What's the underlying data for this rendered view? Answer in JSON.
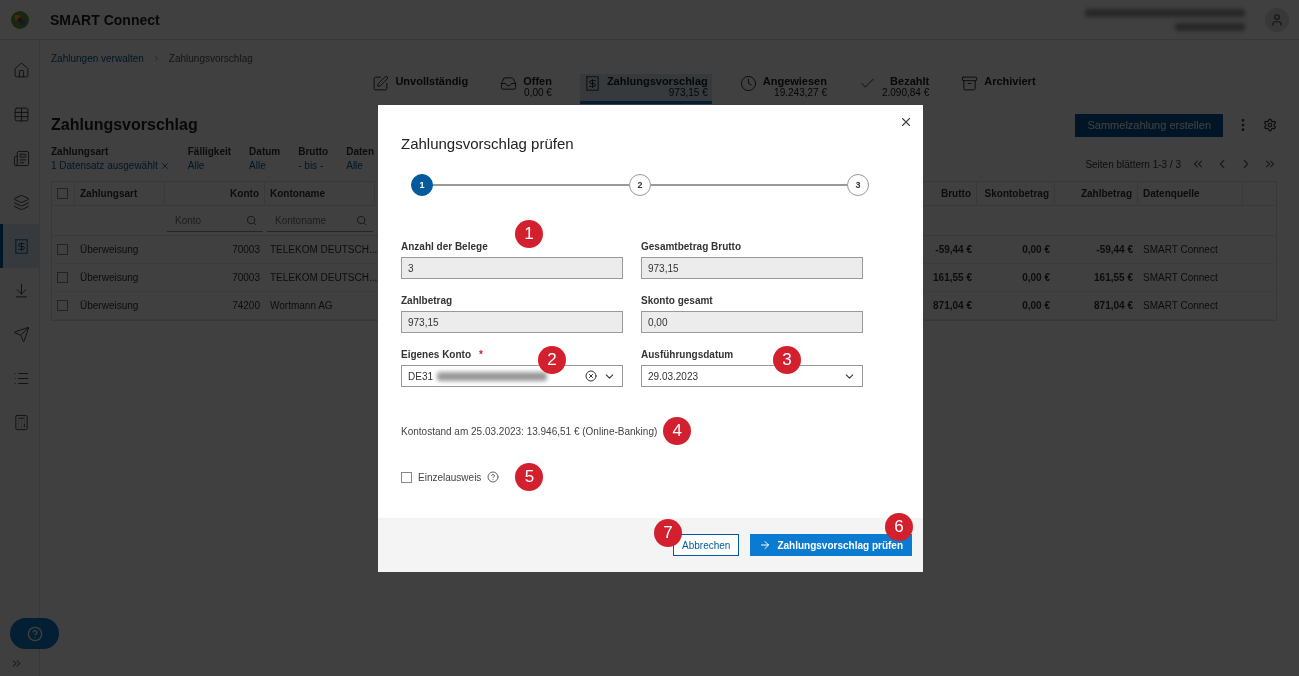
{
  "app": {
    "title": "SMART Connect"
  },
  "sidebar": {
    "items": [
      {
        "selected": false
      },
      {
        "selected": false
      },
      {
        "selected": false
      },
      {
        "selected": false
      },
      {
        "selected": true
      },
      {
        "selected": false
      },
      {
        "selected": false
      },
      {
        "selected": false
      },
      {
        "selected": false
      }
    ]
  },
  "breadcrumbs": [
    "Zahlungen verwalten",
    "Zahlungsvorschlag"
  ],
  "status_tabs": [
    {
      "label": "Unvollständig",
      "selected": false
    },
    {
      "label": "Offen",
      "amount": "0,00 €",
      "selected": false
    },
    {
      "label": "Zahlungsvorschlag",
      "amount": "973,15 €",
      "selected": true
    },
    {
      "label": "Angewiesen",
      "amount": "19.243,27 €",
      "selected": false
    },
    {
      "label": "Bezahlt",
      "amount": "2.090,84 €",
      "selected": false
    },
    {
      "label": "Archiviert",
      "selected": false
    }
  ],
  "page_title": "Zahlungsvorschlag",
  "action_button": "Sammelzahlung erstellen",
  "filters": [
    {
      "label": "Zahlungsart",
      "value": "1 Datensatz ausgewählt",
      "clearable": true
    },
    {
      "label": "Fälligkeit",
      "value": "Alle",
      "clearable": false
    },
    {
      "label": "Datum",
      "value": "Alle",
      "clearable": false
    },
    {
      "label": "Brutto",
      "value": "- bis -",
      "clearable": false
    },
    {
      "label": "Daten",
      "value": "Alle",
      "clearable": false
    }
  ],
  "pagination": "Seiten blättern 1-3 / 3",
  "table": {
    "all_checked": false,
    "columns": [
      "Zahlungsart",
      "Konto",
      "Kontoname",
      "Brutto",
      "Skontobetrag",
      "Zahlbetrag",
      "Datenquelle"
    ],
    "filter_placeholders": [
      "Konto",
      "Kontoname"
    ],
    "rows": [
      {
        "checked": false,
        "cells": [
          "Überweisung",
          "70003",
          "TELEKOM DEUTSCH...",
          "-59,44 €",
          "0,00 €",
          "-59,44 €",
          "SMART Connect"
        ]
      },
      {
        "checked": false,
        "cells": [
          "Überweisung",
          "70003",
          "TELEKOM DEUTSCH...",
          "161,55 €",
          "0,00 €",
          "161,55 €",
          "SMART Connect"
        ]
      },
      {
        "checked": false,
        "cells": [
          "Überweisung",
          "74200",
          "Wortmann AG",
          "871,04 €",
          "0,00 €",
          "871,04 €",
          "SMART Connect"
        ]
      }
    ]
  },
  "dialog": {
    "title": "Zahlungsvorschlag prüfen",
    "steps": [
      {
        "label": "1",
        "selected": true
      },
      {
        "label": "2",
        "selected": false
      },
      {
        "label": "3",
        "selected": false
      }
    ],
    "fields": [
      {
        "kind": "readonly",
        "label": "Anzahl der Belege",
        "value": "3",
        "marker": "1"
      },
      {
        "kind": "readonly",
        "label": "Gesamtbetrag Brutto",
        "value": "973,15"
      },
      {
        "kind": "readonly",
        "label": "Zahlbetrag",
        "value": "973,15"
      },
      {
        "kind": "readonly",
        "label": "Skonto gesamt",
        "value": "0,00"
      },
      {
        "kind": "select",
        "label": "Eigenes Konto",
        "required_mark": "*",
        "value": "DE31",
        "redacted": true,
        "clearable": true,
        "marker": "2"
      },
      {
        "kind": "select",
        "label": "Ausführungsdatum",
        "value": "29.03.2023",
        "marker": "3"
      }
    ],
    "balance": {
      "text": "Kontostand am 25.03.2023: 13.946,51 € (Online-Banking)",
      "marker": "4"
    },
    "checkbox": {
      "label": "Einzelausweis",
      "checked": false,
      "marker": "5"
    },
    "buttons": [
      {
        "kind": "secondary",
        "label": "Abbrechen",
        "marker": "7"
      },
      {
        "kind": "primary",
        "label": "Zahlungsvorschlag prüfen",
        "marker": "6"
      }
    ]
  }
}
